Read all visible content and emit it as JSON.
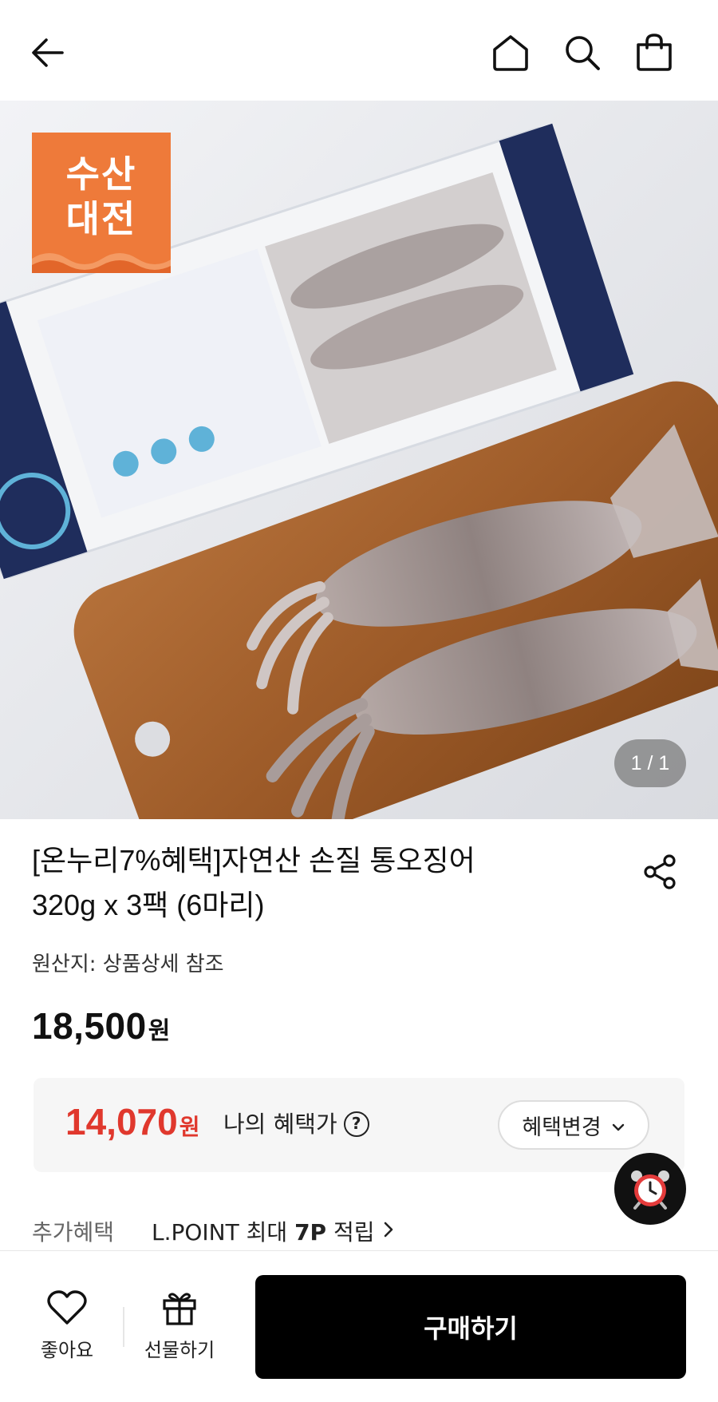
{
  "header": {
    "back_icon": "arrow-left-icon",
    "home_icon": "home-icon",
    "search_icon": "search-icon",
    "cart_icon": "shopping-bag-icon"
  },
  "gallery": {
    "badge_line1": "수산",
    "badge_line2": "대전",
    "badge_color": "#ee7a3a",
    "counter": "1 / 1"
  },
  "product": {
    "title_line1": "[온누리7%혜택]자연산 손질 통오징어",
    "title_line2": "320g x 3팩 (6마리)",
    "origin": "원산지: 상품상세 참조",
    "price": "18,500",
    "price_unit": "원"
  },
  "benefit": {
    "price": "14,070",
    "price_unit": "원",
    "label": "나의 혜택가",
    "help": "?",
    "change_label": "혜택변경",
    "accent_color": "#e0382d"
  },
  "extra": {
    "label": "추가혜택",
    "text_pre": "L.POINT 최대 ",
    "text_bold": "7P",
    "text_post": " 적립"
  },
  "bottom_bar": {
    "like_label": "좋아요",
    "gift_label": "선물하기",
    "buy_label": "구매하기"
  }
}
